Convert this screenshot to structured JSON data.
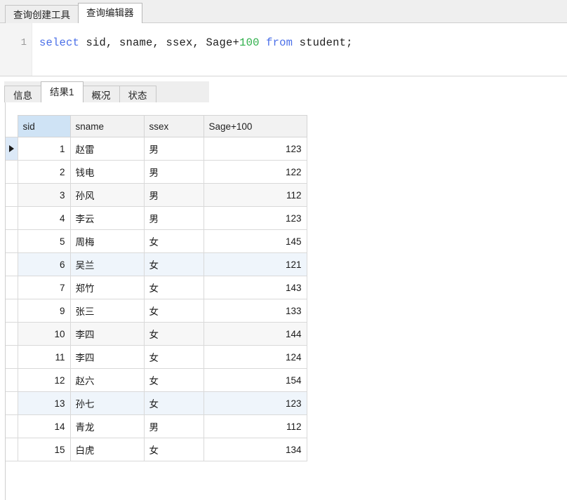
{
  "top_tabs": [
    {
      "label": "查询创建工具",
      "active": false
    },
    {
      "label": "查询编辑器",
      "active": true
    }
  ],
  "editor": {
    "line_number": "1",
    "code": {
      "kw_select": "select",
      "mid": " sid, sname, ssex, Sage+",
      "num_100": "100",
      "kw_from": " from",
      "tail": " student;"
    },
    "full_text": "select sid, sname, ssex, Sage+100 from student;",
    "colors": {
      "keyword": "#4a6fe8",
      "number": "#2eaf4a",
      "text": "#202020",
      "gutter_bg": "#f4f4f4"
    }
  },
  "result_tabs": [
    {
      "label": "信息",
      "active": false
    },
    {
      "label": "结果1",
      "active": true
    },
    {
      "label": "概况",
      "active": false
    },
    {
      "label": "状态",
      "active": false
    }
  ],
  "grid": {
    "selected_column": "sid",
    "current_row_index": 0,
    "columns": [
      {
        "key": "sid",
        "label": "sid",
        "align": "right"
      },
      {
        "key": "name",
        "label": "sname",
        "align": "left"
      },
      {
        "key": "sex",
        "label": "ssex",
        "align": "left"
      },
      {
        "key": "age",
        "label": "Sage+100",
        "align": "right"
      }
    ],
    "rows": [
      {
        "sid": "1",
        "name": "赵雷",
        "sex": "男",
        "age": "123",
        "tint": "white"
      },
      {
        "sid": "2",
        "name": "钱电",
        "sex": "男",
        "age": "122",
        "tint": "white"
      },
      {
        "sid": "3",
        "name": "孙风",
        "sex": "男",
        "age": "112",
        "tint": "gray"
      },
      {
        "sid": "4",
        "name": "李云",
        "sex": "男",
        "age": "123",
        "tint": "white"
      },
      {
        "sid": "5",
        "name": "周梅",
        "sex": "女",
        "age": "145",
        "tint": "white"
      },
      {
        "sid": "6",
        "name": "吴兰",
        "sex": "女",
        "age": "121",
        "tint": "blue"
      },
      {
        "sid": "7",
        "name": "郑竹",
        "sex": "女",
        "age": "143",
        "tint": "white"
      },
      {
        "sid": "9",
        "name": "张三",
        "sex": "女",
        "age": "133",
        "tint": "white"
      },
      {
        "sid": "10",
        "name": "李四",
        "sex": "女",
        "age": "144",
        "tint": "gray"
      },
      {
        "sid": "11",
        "name": "李四",
        "sex": "女",
        "age": "124",
        "tint": "white"
      },
      {
        "sid": "12",
        "name": "赵六",
        "sex": "女",
        "age": "154",
        "tint": "white"
      },
      {
        "sid": "13",
        "name": "孙七",
        "sex": "女",
        "age": "123",
        "tint": "blue"
      },
      {
        "sid": "14",
        "name": "青龙",
        "sex": "男",
        "age": "112",
        "tint": "white"
      },
      {
        "sid": "15",
        "name": "白虎",
        "sex": "女",
        "age": "134",
        "tint": "white"
      }
    ]
  },
  "colors": {
    "header_bg": "#f2f2f2",
    "selected_header_bg": "#cfe3f5",
    "row_tint_gray": "#f7f7f7",
    "row_tint_blue": "#eff5fb",
    "grid_line": "#d9d9d9",
    "tabstrip_bg": "#efefef"
  }
}
